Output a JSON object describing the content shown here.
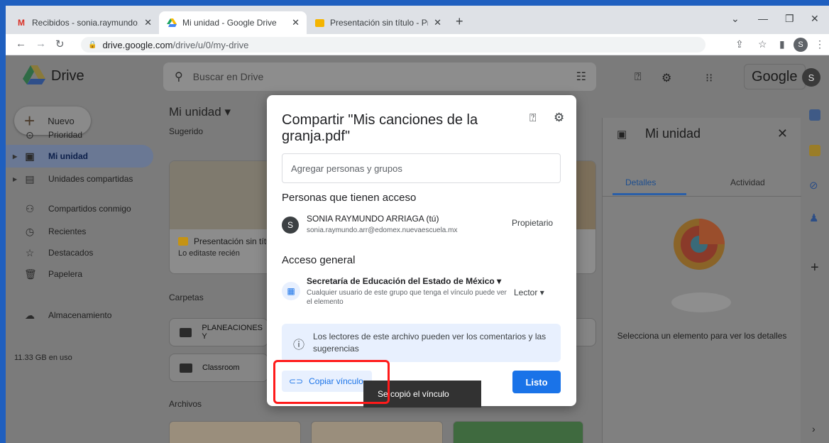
{
  "browser": {
    "tabs": [
      {
        "title": "Recibidos - sonia.raymundo.arr@",
        "favicon": "gmail-icon"
      },
      {
        "title": "Mi unidad - Google Drive",
        "favicon": "drive-icon"
      },
      {
        "title": "Presentación sin título - Presenta",
        "favicon": "slides-icon"
      }
    ],
    "url_host": "drive.google.com",
    "url_path": "/drive/u/0/my-drive",
    "profile_initial": "S"
  },
  "drive": {
    "app_name": "Drive",
    "search_placeholder": "Buscar en Drive",
    "brand": "Google",
    "avatar_initial": "S",
    "new_label": "Nuevo",
    "nav": [
      {
        "label": "Prioridad",
        "icon": "check-circle-icon"
      },
      {
        "label": "Mi unidad",
        "icon": "my-drive-icon"
      },
      {
        "label": "Unidades compartidas",
        "icon": "shared-drives-icon"
      },
      {
        "label": "Compartidos conmigo",
        "icon": "people-icon"
      },
      {
        "label": "Recientes",
        "icon": "clock-icon"
      },
      {
        "label": "Destacados",
        "icon": "star-icon"
      },
      {
        "label": "Papelera",
        "icon": "trash-icon"
      },
      {
        "label": "Almacenamiento",
        "icon": "cloud-icon"
      }
    ],
    "storage_used": "11.33 GB en uso",
    "main_title": "Mi unidad",
    "suggested_label": "Sugerido",
    "suggested_card": {
      "title": "Presentación sin títul",
      "subtitle": "Lo editaste recién"
    },
    "folders_label": "Carpetas",
    "folders": [
      "PLANEACIONES Y",
      "Classroom"
    ],
    "files_label": "Archivos",
    "details": {
      "title": "Mi unidad",
      "tab_details": "Detalles",
      "tab_activity": "Actividad",
      "empty_text": "Selecciona un elemento para ver los detalles"
    }
  },
  "share_dialog": {
    "title": "Compartir \"Mis canciones de la granja.pdf\"",
    "add_placeholder": "Agregar personas y grupos",
    "people_section": "Personas que tienen acceso",
    "person": {
      "initial": "S",
      "name": "SONIA RAYMUNDO ARRIAGA (tú)",
      "email": "sonia.raymundo.arr@edomex.nuevaescuela.mx",
      "role": "Propietario"
    },
    "general_section": "Acceso general",
    "org": {
      "name": "Secretaría de Educación del Estado de México",
      "description": "Cualquier usuario de este grupo que tenga el vínculo puede ver el elemento",
      "role": "Lector"
    },
    "info": "Los lectores de este archivo pueden ver los comentarios y las sugerencias",
    "copy_link": "Copiar vínculo",
    "done": "Listo"
  },
  "toast": "Se copió el vínculo",
  "colors": {
    "accent": "#1a73e8",
    "highlight": "#ff1a1a",
    "window_border": "#1f5fbf"
  }
}
